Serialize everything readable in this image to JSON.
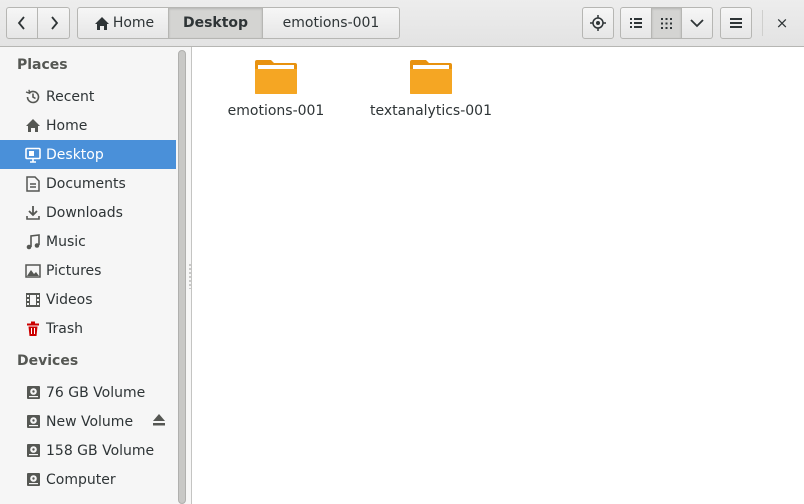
{
  "header": {
    "back_icon": "chevron-left-icon",
    "forward_icon": "chevron-right-icon",
    "breadcrumbs": [
      {
        "label": "Home",
        "icon": "home-icon"
      },
      {
        "label": "Desktop"
      },
      {
        "label": "emotions-001"
      }
    ],
    "location_icon": "crosshair-icon",
    "list_view_icon": "list-view-icon",
    "grid_view_icon": "grid-view-icon",
    "view_options_icon": "chevron-down-icon",
    "menu_icon": "hamburger-menu-icon",
    "close_label": "×"
  },
  "sidebar": {
    "places_heading": "Places",
    "places": [
      {
        "label": "Recent",
        "icon": "clock-icon"
      },
      {
        "label": "Home",
        "icon": "home-icon"
      },
      {
        "label": "Desktop",
        "icon": "desktop-icon",
        "selected": true
      },
      {
        "label": "Documents",
        "icon": "document-icon"
      },
      {
        "label": "Downloads",
        "icon": "download-icon"
      },
      {
        "label": "Music",
        "icon": "music-icon"
      },
      {
        "label": "Pictures",
        "icon": "picture-icon"
      },
      {
        "label": "Videos",
        "icon": "film-icon"
      },
      {
        "label": "Trash",
        "icon": "trash-icon"
      }
    ],
    "devices_heading": "Devices",
    "devices": [
      {
        "label": "76 GB Volume",
        "icon": "drive-icon"
      },
      {
        "label": "New Volume",
        "icon": "drive-icon",
        "eject": true
      },
      {
        "label": "158 GB Volume",
        "icon": "drive-icon"
      },
      {
        "label": "Computer",
        "icon": "drive-icon"
      }
    ]
  },
  "files": [
    {
      "name": "emotions-001",
      "icon": "folder-icon"
    },
    {
      "name": "textanalytics-001",
      "icon": "folder-icon"
    }
  ],
  "colors": {
    "accent": "#4a90d9",
    "folder": "#f5a623",
    "folder_dark": "#e8920f",
    "trash": "#cc0000"
  }
}
